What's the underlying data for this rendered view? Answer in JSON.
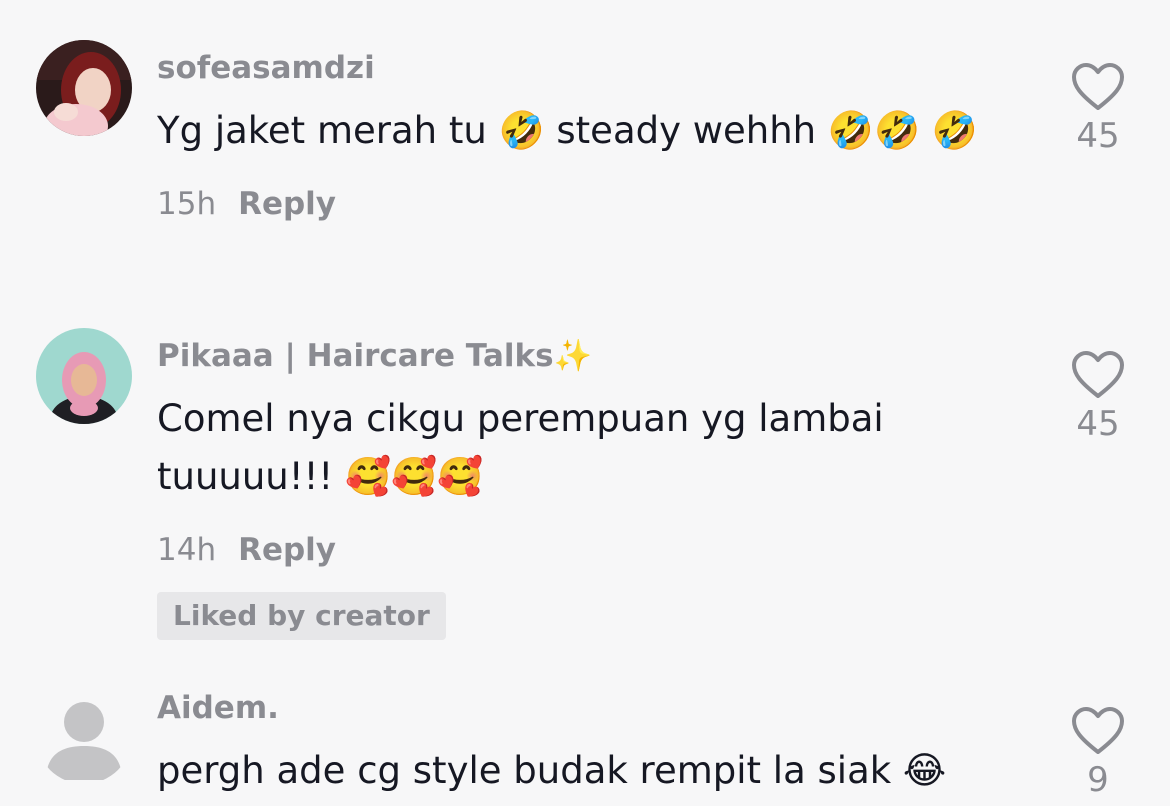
{
  "comments": [
    {
      "username": "sofeasamdzi",
      "text": "Yg jaket merah tu 🤣 steady wehhh 🤣🤣 🤣",
      "time": "15h",
      "reply_label": "Reply",
      "likes": "45",
      "avatar_icon": "profile-photo-icon"
    },
    {
      "username": "Pikaaa | Haircare Talks✨",
      "text": "Comel nya cikgu perempuan yg lambai tuuuuu!!! 🥰🥰🥰",
      "time": "14h",
      "reply_label": "Reply",
      "badge": "Liked by creator",
      "likes": "45",
      "avatar_icon": "profile-photo-icon"
    },
    {
      "username": "Aidem.",
      "text": "pergh ade cg style budak rempit la siak 😂",
      "likes": "9",
      "avatar_icon": "default-avatar-icon"
    }
  ],
  "colors": {
    "background": "#f7f7f8",
    "text_primary": "#161823",
    "text_secondary": "#8a8b91",
    "badge_bg": "#e7e7e9"
  },
  "icons": {
    "like": "heart-outline-icon"
  }
}
